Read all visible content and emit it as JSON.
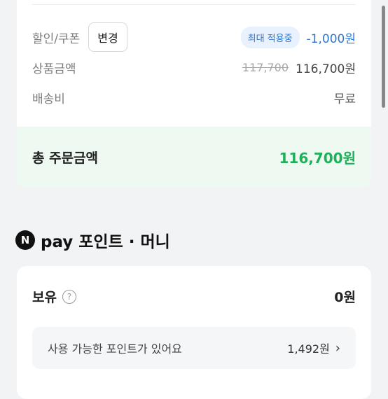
{
  "order_summary": {
    "discount": {
      "label": "할인/쿠폰",
      "change_button": "변경",
      "badge": "최대 적용중",
      "value": "-1,000원"
    },
    "product_amount": {
      "label": "상품금액",
      "original_price": "117,700",
      "price": "116,700원"
    },
    "shipping": {
      "label": "배송비",
      "value": "무료"
    },
    "total": {
      "label": "총 주문금액",
      "value": "116,700원"
    }
  },
  "npay": {
    "logo_letter": "N",
    "title": "pay 포인트 · 머니",
    "holding_label": "보유",
    "help_icon_glyph": "?",
    "holding_value": "0원",
    "available_label": "사용 가능한 포인트가 있어요",
    "available_value": "1,492원",
    "chevron": "›"
  },
  "colors": {
    "accent_blue": "#2f76d2",
    "total_green": "#1fb05a",
    "total_bg": "#eefaf1"
  }
}
